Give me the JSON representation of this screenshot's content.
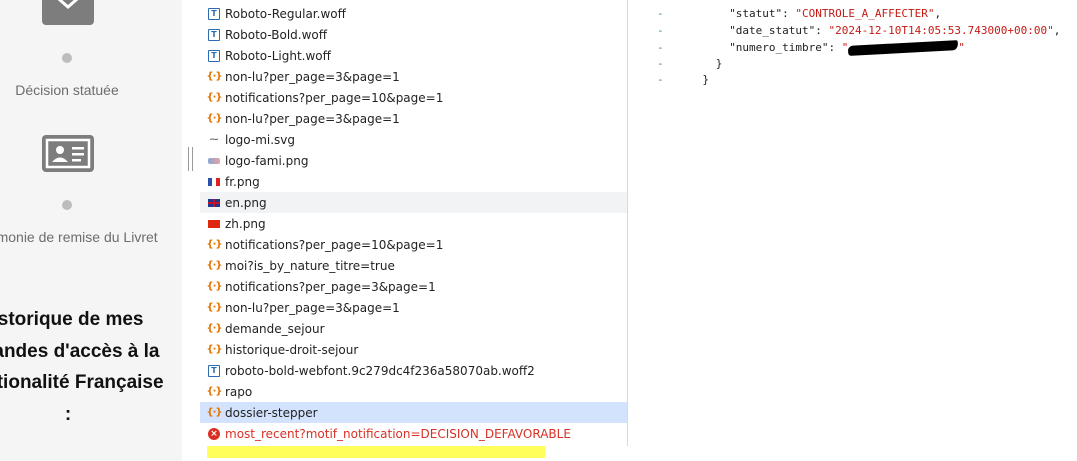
{
  "stepper": {
    "steps": [
      {
        "label": "Décision statuée",
        "icon": "envelope-icon"
      },
      {
        "label": "érémonie de remise du Livret",
        "icon": "id-card-icon"
      }
    ],
    "history_title": "istorique de mes mandes d'accès à la Nationalité Française :"
  },
  "requests": [
    {
      "name": "Roboto-Regular.woff",
      "type": "font"
    },
    {
      "name": "Roboto-Bold.woff",
      "type": "font"
    },
    {
      "name": "Roboto-Light.woff",
      "type": "font"
    },
    {
      "name": "non-lu?per_page=3&page=1",
      "type": "fetch"
    },
    {
      "name": "notifications?per_page=10&page=1",
      "type": "fetch"
    },
    {
      "name": "non-lu?per_page=3&page=1",
      "type": "fetch"
    },
    {
      "name": "logo-mi.svg",
      "type": "svg"
    },
    {
      "name": "logo-fami.png",
      "type": "png-fami"
    },
    {
      "name": "fr.png",
      "type": "png-fr"
    },
    {
      "name": "en.png",
      "type": "png-en"
    },
    {
      "name": "zh.png",
      "type": "png-zh"
    },
    {
      "name": "notifications?per_page=10&page=1",
      "type": "fetch"
    },
    {
      "name": "moi?is_by_nature_titre=true",
      "type": "fetch"
    },
    {
      "name": "notifications?per_page=3&page=1",
      "type": "fetch"
    },
    {
      "name": "non-lu?per_page=3&page=1",
      "type": "fetch"
    },
    {
      "name": "demande_sejour",
      "type": "fetch"
    },
    {
      "name": "historique-droit-sejour",
      "type": "fetch"
    },
    {
      "name": "roboto-bold-webfont.9c279dc4f236a58070ab.woff2",
      "type": "font"
    },
    {
      "name": "rapo",
      "type": "fetch"
    },
    {
      "name": "dossier-stepper",
      "type": "fetch"
    },
    {
      "name": "most_recent?motif_notification=DECISION_DEFAVORABLE",
      "type": "error"
    }
  ],
  "icons": {
    "font": "T",
    "fetch": "{·}",
    "svg": "⁓",
    "error": "×"
  },
  "json_panel": {
    "lines": [
      {
        "mark": "-",
        "indent": 6,
        "key": "\"statut\"",
        "value": "\"CONTROLE_A_AFFECTER\"",
        "tail": ","
      },
      {
        "mark": "-",
        "indent": 6,
        "key": "\"date_statut\"",
        "value": "\"2024-12-10T14:05:53.743000+00:00\"",
        "tail": ","
      },
      {
        "mark": "-",
        "indent": 6,
        "key": "\"numero_timbre\"",
        "value": "\"",
        "redacted": true,
        "tail": "\""
      },
      {
        "mark": "-",
        "indent": 4,
        "text": "}"
      },
      {
        "mark": "-",
        "indent": 2,
        "text": "}"
      }
    ]
  },
  "colors": {
    "highlight": "#ffff40",
    "selected_row": "#d3e3fd",
    "error_text": "#d93025",
    "json_value": "#c41a16"
  }
}
